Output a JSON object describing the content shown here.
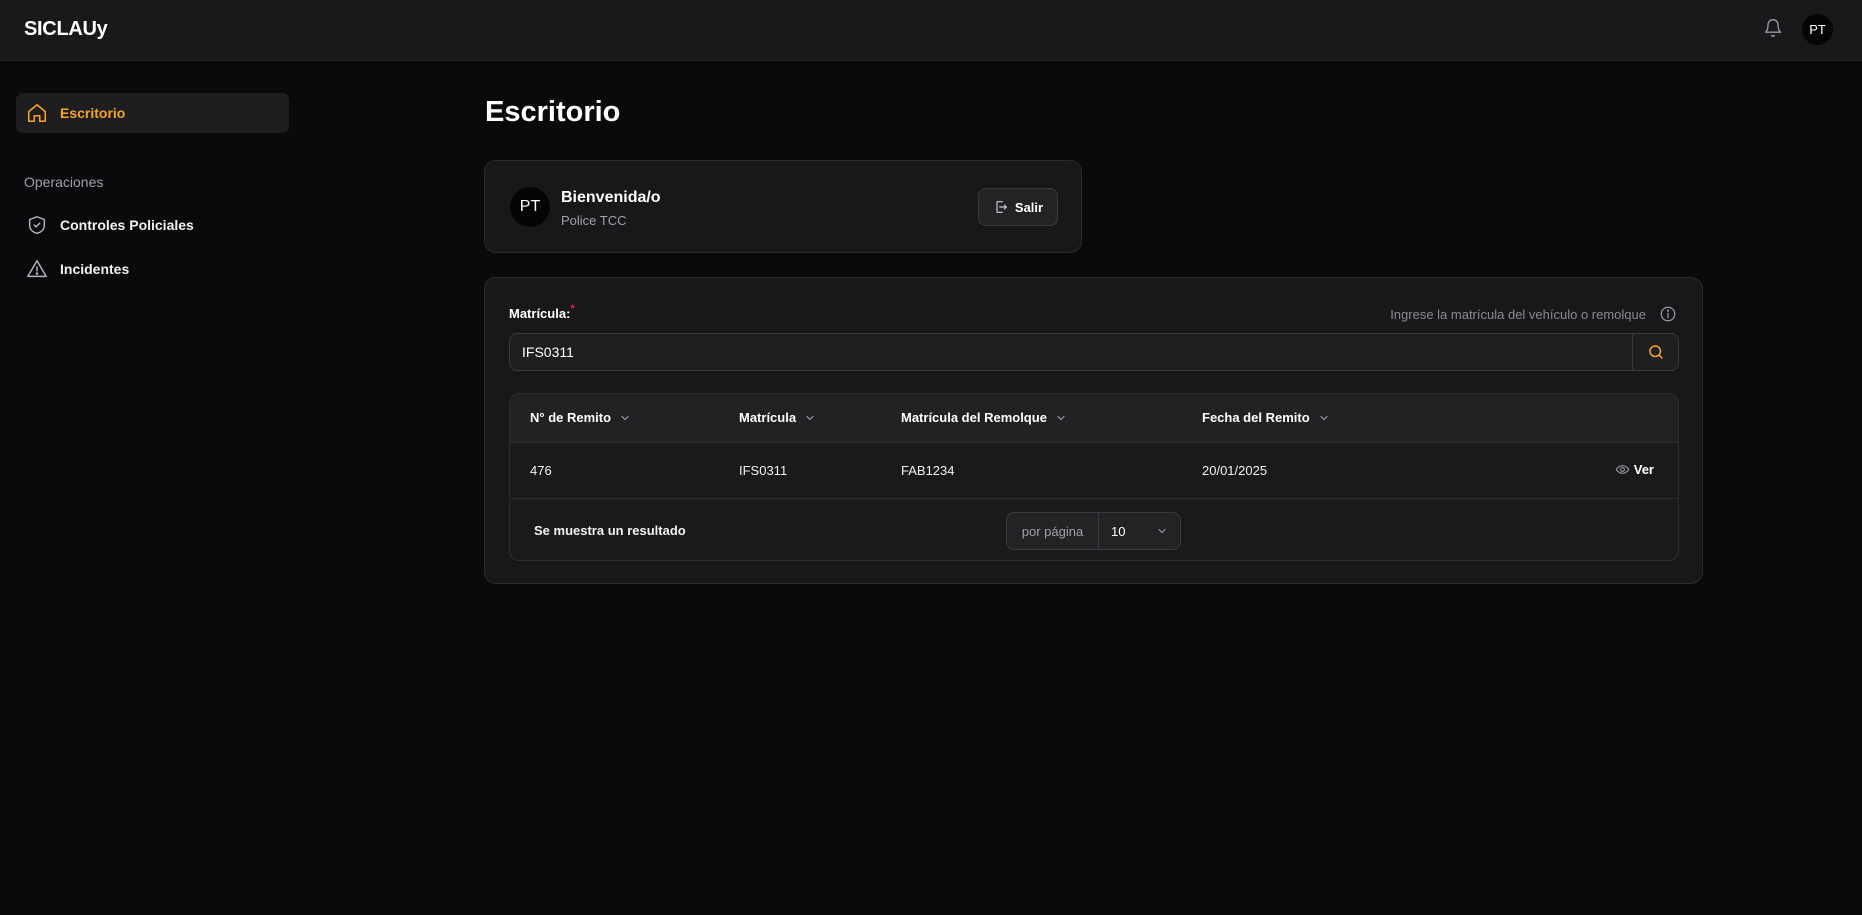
{
  "app": {
    "brand": "SICLAUy",
    "user_initials": "PT"
  },
  "sidebar": {
    "items": [
      {
        "label": "Escritorio",
        "icon": "home-icon",
        "active": true
      },
      {
        "label": "Controles Policiales",
        "icon": "shield-check-icon"
      },
      {
        "label": "Incidentes",
        "icon": "warning-triangle-icon"
      }
    ],
    "section_label": "Operaciones"
  },
  "main": {
    "title": "Escritorio",
    "welcome": {
      "avatar": "PT",
      "title": "Bienvenida/o",
      "subtitle": "Police TCC",
      "logout_label": "Salir"
    },
    "search": {
      "label": "Matrícula:",
      "required_mark": "*",
      "hint": "Ingrese la matrícula del vehículo o remolque",
      "value": "IFS0311"
    },
    "table": {
      "columns": [
        "N° de Remito",
        "Matrícula",
        "Matrícula del Remolque",
        "Fecha del Remito"
      ],
      "rows": [
        {
          "remito": "476",
          "matricula": "IFS0311",
          "remolque": "FAB1234",
          "fecha": "20/01/2025",
          "action": "Ver"
        }
      ],
      "result_text": "Se muestra un resultado",
      "per_page_label": "por página",
      "per_page_value": "10"
    }
  },
  "colors": {
    "accent": "#f5a524",
    "background": "#0a0a0c",
    "card": "#18181a",
    "danger": "#f31260"
  }
}
